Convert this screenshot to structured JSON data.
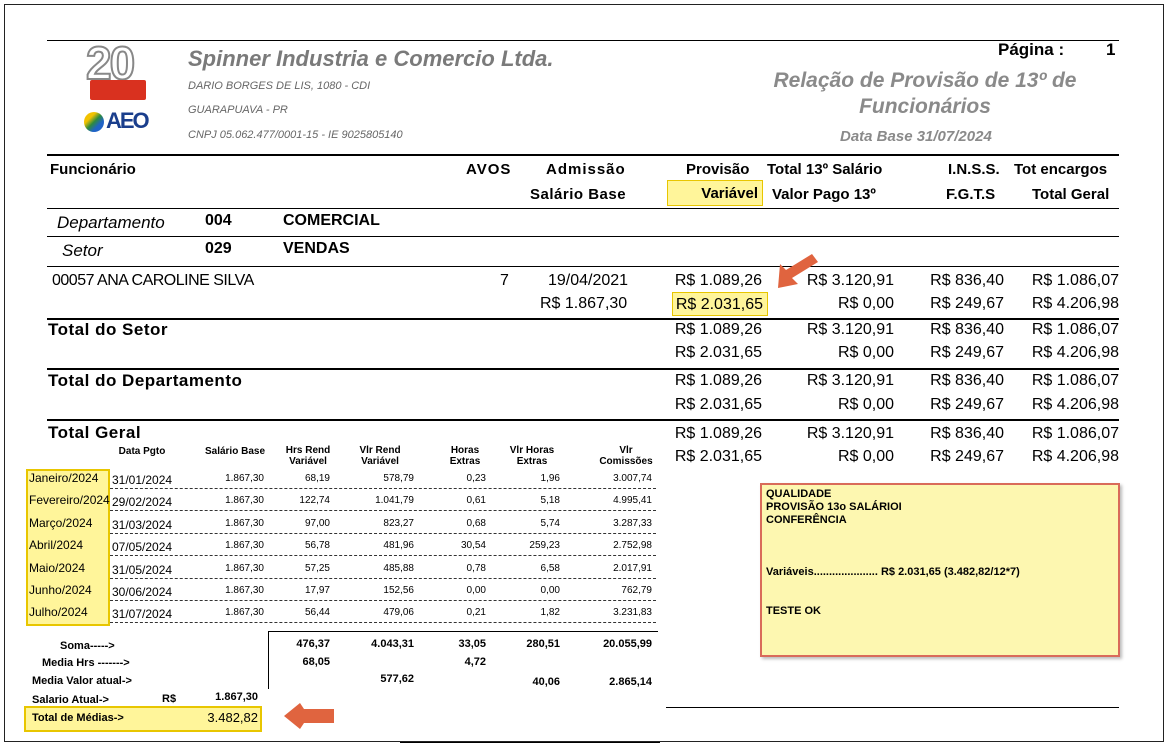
{
  "header": {
    "company": "Spinner Industria e Comercio Ltda.",
    "address": "DARIO BORGES DE LIS, 1080 - CDI",
    "city": "GUARAPUAVA - PR",
    "cnpj": "CNPJ 05.062.477/0001-15   -   IE 9025805140",
    "page_label": "Página :",
    "page_number": "1",
    "report_title_line1": "Relação de Provisão de 13º de",
    "report_title_line2": "Funcionários",
    "base_date": "Data Base 31/07/2024",
    "logo_year": "20",
    "logo_brand": "AEO"
  },
  "columns": {
    "funcionario": "Funcionário",
    "avos": "AVOS",
    "admissao": "Admissão",
    "salario_base": "Salário Base",
    "provisao": "Provisão",
    "variavel": "Variável",
    "total13": "Total 13º Salário",
    "valor_pago13": "Valor Pago 13º",
    "inss": "I.N.S.S.",
    "fgts": "F.G.T.S",
    "tot_encargos": "Tot encargos",
    "total_geral": "Total Geral"
  },
  "department": {
    "label": "Departamento",
    "code": "004",
    "name": "COMERCIAL"
  },
  "sector": {
    "label": "Setor",
    "code": "029",
    "name": "VENDAS"
  },
  "employee": {
    "name": "00057 ANA CAROLINE SILVA",
    "avos": "7",
    "admissao": "19/04/2021",
    "salario_base": "R$ 1.867,30",
    "row1": {
      "provisao": "R$ 1.089,26",
      "total13": "R$ 3.120,91",
      "inss": "R$ 836,40",
      "encargos": "R$ 1.086,07"
    },
    "row2": {
      "variavel": "R$ 2.031,65",
      "pago13": "R$ 0,00",
      "fgts": "R$ 249,67",
      "total": "R$ 4.206,98"
    }
  },
  "totals": {
    "setor_label": "Total do Setor",
    "depto_label": "Total do Departamento",
    "geral_label": "Total Geral",
    "row1": {
      "provisao": "R$ 1.089,26",
      "total13": "R$ 3.120,91",
      "inss": "R$ 836,40",
      "encargos": "R$ 1.086,07"
    },
    "row2": {
      "variavel": "R$ 2.031,65",
      "pago13": "R$ 0,00",
      "fgts": "R$ 249,67",
      "total": "R$ 4.206,98"
    }
  },
  "months_table": {
    "headers": [
      "Data Pgto",
      "Salário Base",
      "Hrs Rend Variável",
      "Vlr Rend Variável",
      "Horas Extras",
      "Vlr Horas Extras",
      "Vlr Comissões"
    ],
    "rows": [
      {
        "month": "Janeiro/2024",
        "date": "31/01/2024",
        "salario": "1.867,30",
        "hrs": "68,19",
        "vlr": "578,79",
        "he": "0,23",
        "vhe": "1,96",
        "com": "3.007,74"
      },
      {
        "month": "Fevereiro/2024",
        "date": "29/02/2024",
        "salario": "1.867,30",
        "hrs": "122,74",
        "vlr": "1.041,79",
        "he": "0,61",
        "vhe": "5,18",
        "com": "4.995,41"
      },
      {
        "month": "Março/2024",
        "date": "31/03/2024",
        "salario": "1.867,30",
        "hrs": "97,00",
        "vlr": "823,27",
        "he": "0,68",
        "vhe": "5,74",
        "com": "3.287,33"
      },
      {
        "month": "Abril/2024",
        "date": "07/05/2024",
        "salario": "1.867,30",
        "hrs": "56,78",
        "vlr": "481,96",
        "he": "30,54",
        "vhe": "259,23",
        "com": "2.752,98"
      },
      {
        "month": "Maio/2024",
        "date": "31/05/2024",
        "salario": "1.867,30",
        "hrs": "57,25",
        "vlr": "485,88",
        "he": "0,78",
        "vhe": "6,58",
        "com": "2.017,91"
      },
      {
        "month": "Junho/2024",
        "date": "30/06/2024",
        "salario": "1.867,30",
        "hrs": "17,97",
        "vlr": "152,56",
        "he": "0,00",
        "vhe": "0,00",
        "com": "762,79"
      },
      {
        "month": "Julho/2024",
        "date": "31/07/2024",
        "salario": "1.867,30",
        "hrs": "56,44",
        "vlr": "479,06",
        "he": "0,21",
        "vhe": "1,82",
        "com": "3.231,83"
      }
    ],
    "soma_label": "Soma----->",
    "soma": {
      "hrs": "476,37",
      "vlr": "4.043,31",
      "he": "33,05",
      "vhe": "280,51",
      "com": "20.055,99"
    },
    "media_hrs_label": "Media Hrs ------->",
    "media_hrs": {
      "hrs": "68,05",
      "he": "4,72"
    },
    "media_valor_label": "Media Valor atual->",
    "media_valor": {
      "vlr": "577,62",
      "vhe": "40,06",
      "com": "2.865,14"
    },
    "salario_atual_label": "Salario Atual->",
    "salario_atual_currency": "R$",
    "salario_atual": "1.867,30",
    "total_medias_label": "Total de Médias->",
    "total_medias": "3.482,82"
  },
  "note": {
    "line1": "QUALIDADE",
    "line2": "PROVISÃO 13o SALÁRIOI",
    "line3": "CONFERÊNCIA",
    "line4": "Variáveis..................... R$ 2.031,65 (3.482,82/12*7)",
    "line5": "TESTE OK"
  },
  "colors": {
    "highlight": "#fff59a",
    "arrow": "#e0643f",
    "note_bg": "#fdf7b0",
    "note_border": "#d96b5a"
  }
}
